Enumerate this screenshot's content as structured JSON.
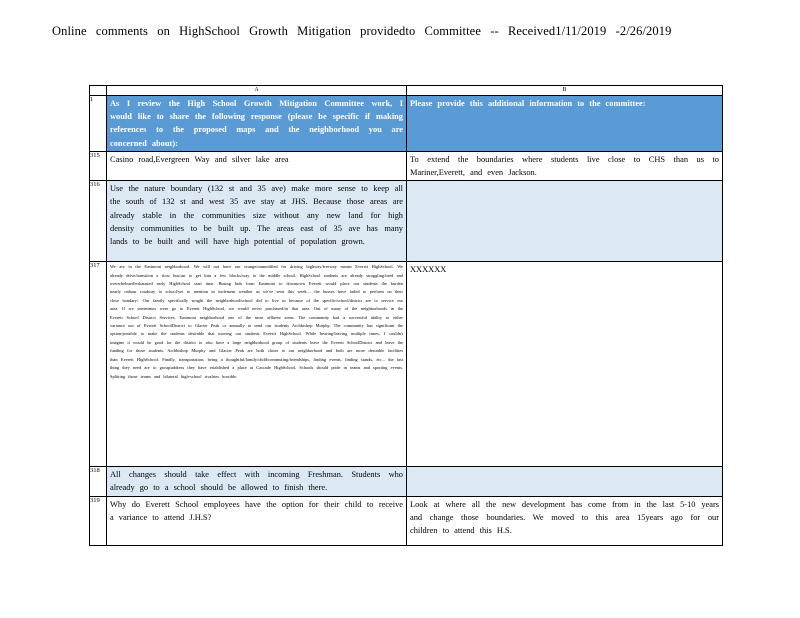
{
  "header": {
    "title": "Online comments on HighSchool Growth Mitigation providedto Committee -- Received1/11/2019 -2/26/2019"
  },
  "sheet": {
    "columns": [
      "A",
      "B"
    ],
    "header_row": {
      "num": "1",
      "a": "As I review the High School Growth Mitigation Committee work, I would like to share the following response (please be specific if making references to the proposed maps and the neighborhood you are concerned about):",
      "b": "Please provide this additional information to the committee:"
    },
    "rows": [
      {
        "num": "315",
        "a": "Casino road,Evergreen Way and silver lake area",
        "b": "To extend the boundaries where students live close to CHS than us to Mariner,Everett, and even Jackson."
      },
      {
        "num": "316",
        "a": "Use the nature boundary (132 st and 35 ave) make more sense to keep all the south of 132 st and west 35 ave stay at JHS. Because those areas are already stable in the communities size without any new land for high density communities to be built up. The areas east of 35 ave has many lands to be built and will have high potential of population grown.",
        "b": ""
      },
      {
        "num": "317",
        "a": "We are in the Eastmont neighborhood. We will not have our orange/unmodified for driving highway/freeway means Everett HighSchool. We already drive/transition a slow bus/ust to get him a few blocks/way to the middle school. HighSchool students are already struggling/tired and overwhelmed/exhausted early HighSchool start time. Busing kids from Eastmont to downtown Everett would place our students the burden nearly onhour roadway to school/yet to mention in inclement weather as we've seen this week.... the busses have failed to perform on their close bondary/. Our family specifically sought the neighborhood/school did to live in because of the specific/school/district are to service our area. If we sometimes were go to Everett HighSchool, we would never purchased/in that area. Out of many of the neighborhoods in the Everett School District Services, Eastmont neighborhood one of the most affluent areas. The community had a successful ability to either variance out of Everett SchoolDistrict to Glacier Peak or annually to send our students Archbishop Murphy. The community has significant the option/possible to make the students desirable that moving our students Everett HighSchool. While bearing/leaving multiple times, I couldn't imagine it would be good for the district to also have a large neighborhood group of students leave the Everett SchoolDistrict and leave the funding for those students. Archbishop Murphy and Glacier Peak are both closer to our neighborhood and both are more desirable facilities than Everett HighSchool. Finally, transportation, being a thoughtful/family/child/commuting/friendships, finding events, finding stands, etc... the last thing they need are to group/address they have established a place at Cascade HighSchool. Schools should pride in teams and sporting events. Splitting those teams and bilateral high-school rivalries horrible.",
        "b": "XXXXXX"
      },
      {
        "num": "318",
        "a": "All changes should take effect with incoming Freshman. Students who already go to a school should be allowed to finish there.",
        "b": ""
      },
      {
        "num": "319",
        "a": "Why do Everett School employees have the option for their child to receive a variance to attend J.H.S?",
        "b": "Look at where all the new development has come from in the last 5-10 years and change those boundaries. We moved to this area 15years ago for our children to attend this H.S."
      }
    ]
  }
}
